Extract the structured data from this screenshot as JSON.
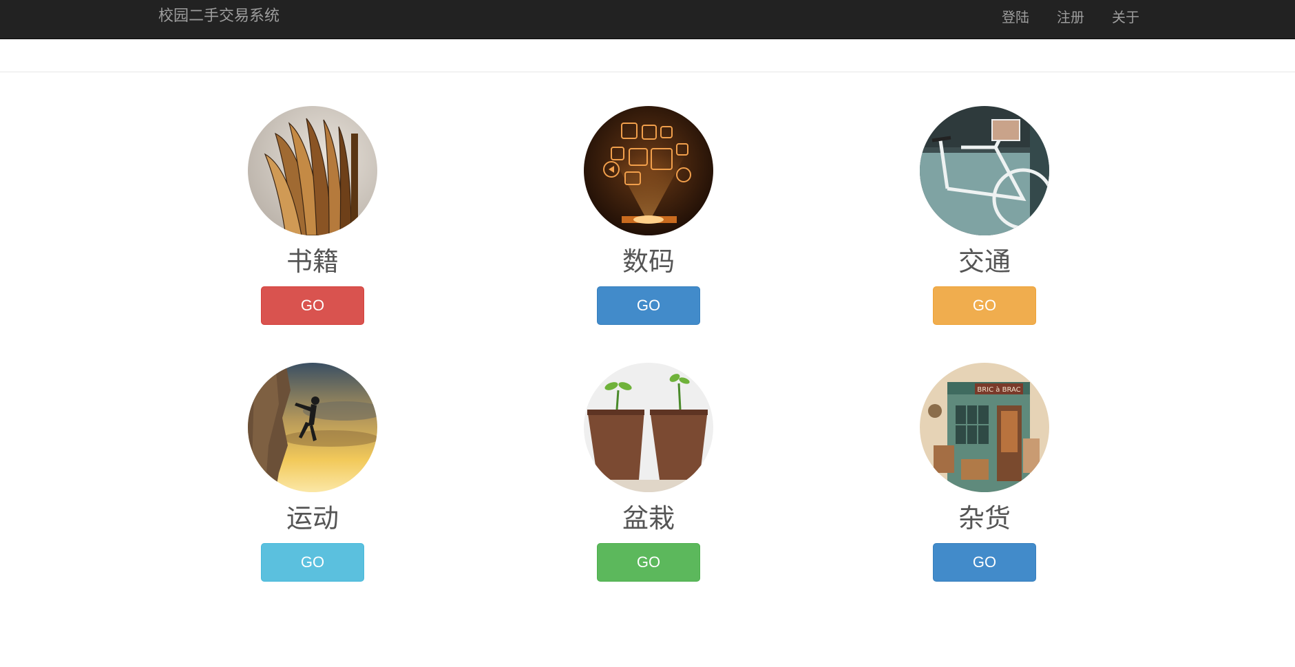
{
  "header": {
    "brand": "校园二手交易系统",
    "links": [
      "登陆",
      "注册",
      "关于"
    ]
  },
  "categories": [
    {
      "name": "书籍",
      "button": "GO",
      "color": "#d9534f",
      "icon": "book-image"
    },
    {
      "name": "数码",
      "button": "GO",
      "color": "#428bca",
      "icon": "digital-hologram-image"
    },
    {
      "name": "交通",
      "button": "GO",
      "color": "#f0ad4e",
      "icon": "bicycle-image"
    },
    {
      "name": "运动",
      "button": "GO",
      "color": "#5bc0de",
      "icon": "rock-climber-image"
    },
    {
      "name": "盆栽",
      "button": "GO",
      "color": "#5cb85c",
      "icon": "seedling-pots-image"
    },
    {
      "name": "杂货",
      "button": "GO",
      "color": "#428bca",
      "icon": "bric-a-brac-shop-image"
    }
  ],
  "shop_sign": "BRIC à BRAC"
}
